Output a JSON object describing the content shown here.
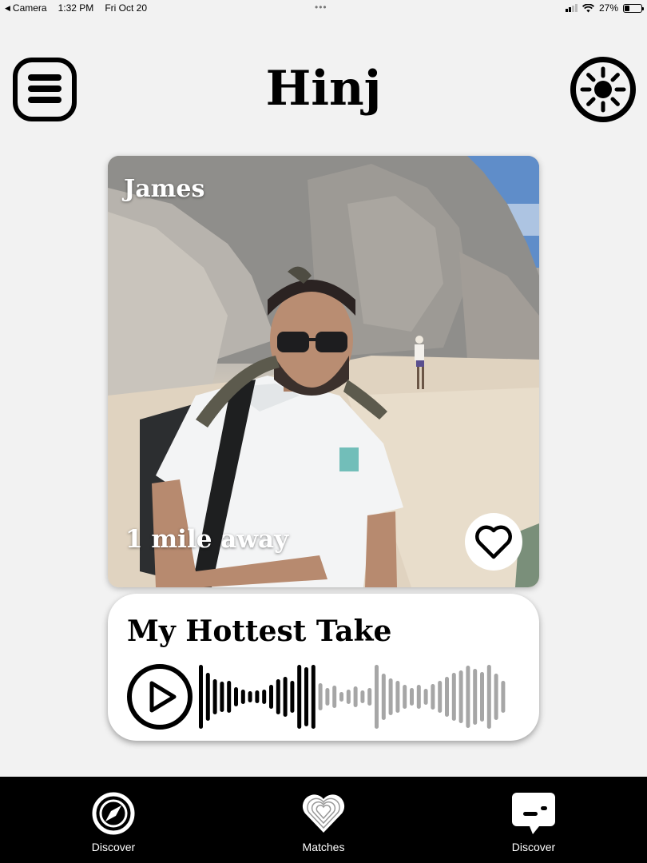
{
  "status_bar": {
    "back_app": "Camera",
    "time": "1:32 PM",
    "date": "Fri Oct 20",
    "center_indicator": "•••",
    "battery": "27%"
  },
  "header": {
    "title": "Hinj",
    "menu_icon": "menu-list-icon",
    "settings_icon": "sun-settings-icon"
  },
  "profile": {
    "name": "James",
    "distance": "1 mile away",
    "like_icon": "heart-icon"
  },
  "prompt": {
    "title": "My Hottest Take",
    "play_icon": "play-icon",
    "progress_fraction": 0.38
  },
  "tabs": [
    {
      "label": "Discover",
      "icon": "compass-icon"
    },
    {
      "label": "Matches",
      "icon": "stacked-hearts-icon"
    },
    {
      "label": "Discover",
      "icon": "chat-bubble-icon"
    }
  ],
  "colors": {
    "background": "#f2f2f2",
    "tab_bar": "#000000",
    "waveform_played": "#000000",
    "waveform_unplayed": "#a6a6a6"
  }
}
